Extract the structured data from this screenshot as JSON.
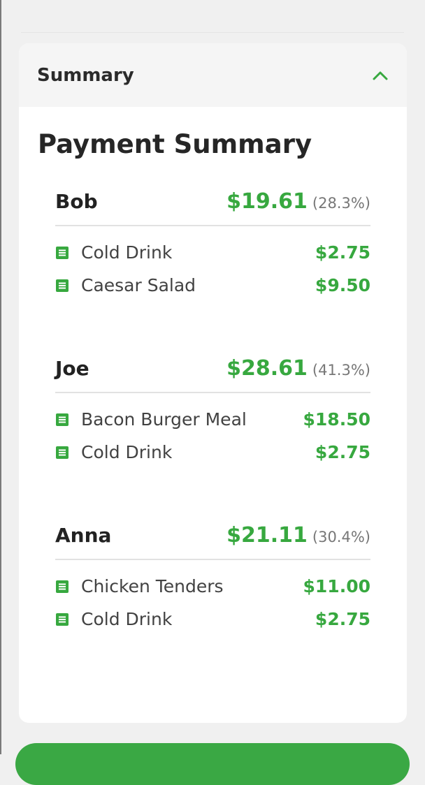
{
  "summary_section": {
    "header": "Summary",
    "title": "Payment Summary"
  },
  "people": [
    {
      "name": "Bob",
      "total": "$19.61",
      "percent": "(28.3%)",
      "items": [
        {
          "name": "Cold Drink",
          "price": "$2.75"
        },
        {
          "name": "Caesar Salad",
          "price": "$9.50"
        }
      ]
    },
    {
      "name": "Joe",
      "total": "$28.61",
      "percent": "(41.3%)",
      "items": [
        {
          "name": "Bacon Burger Meal",
          "price": "$18.50"
        },
        {
          "name": "Cold Drink",
          "price": "$2.75"
        }
      ]
    },
    {
      "name": "Anna",
      "total": "$21.11",
      "percent": "(30.4%)",
      "items": [
        {
          "name": "Chicken Tenders",
          "price": "$11.00"
        },
        {
          "name": "Cold Drink",
          "price": "$2.75"
        }
      ]
    }
  ],
  "icons": {
    "collapse": "chevron-up-icon",
    "item": "receipt-list-icon"
  },
  "colors": {
    "accent": "#37a83f",
    "button": "#3aa844"
  }
}
